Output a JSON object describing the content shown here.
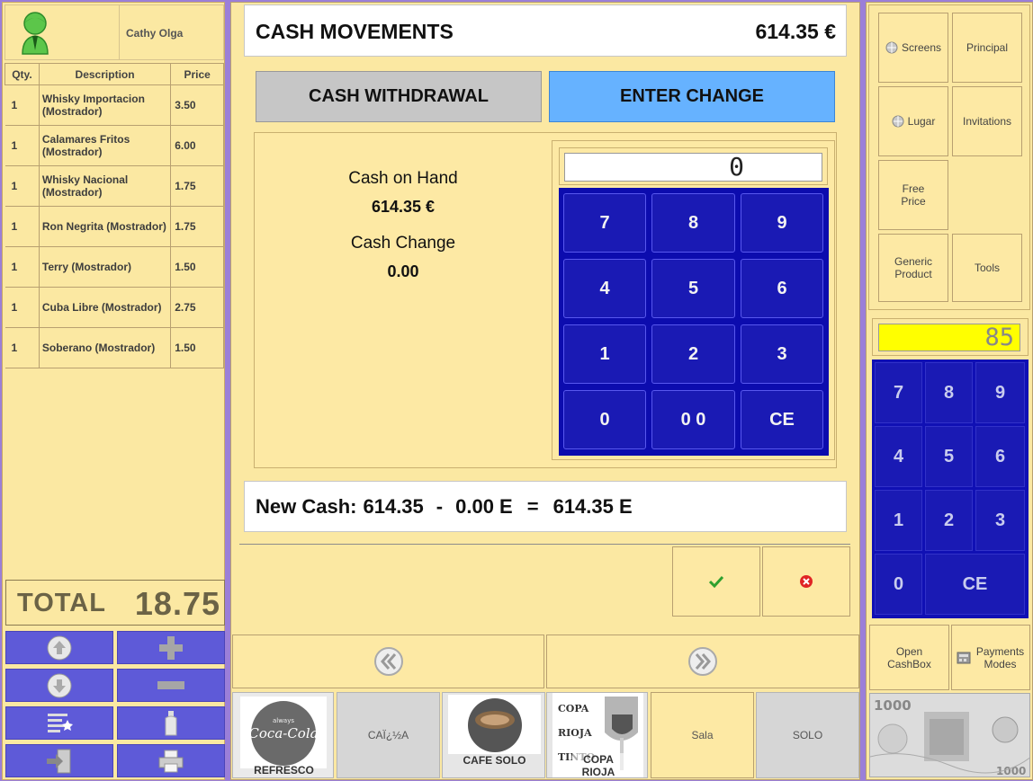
{
  "user": {
    "name": "Cathy Olga"
  },
  "ticket": {
    "headers": {
      "qty": "Qty.",
      "description": "Description",
      "price": "Price"
    },
    "lines": [
      {
        "qty": "1",
        "description": "Whisky Importacion (Mostrador)",
        "price": "3.50"
      },
      {
        "qty": "1",
        "description": "Calamares Fritos (Mostrador)",
        "price": "6.00"
      },
      {
        "qty": "1",
        "description": "Whisky Nacional (Mostrador)",
        "price": "1.75"
      },
      {
        "qty": "1",
        "description": "Ron Negrita (Mostrador)",
        "price": "1.75"
      },
      {
        "qty": "1",
        "description": "Terry (Mostrador)",
        "price": "1.50"
      },
      {
        "qty": "1",
        "description": "Cuba Libre (Mostrador)",
        "price": "2.75"
      },
      {
        "qty": "1",
        "description": "Soberano (Mostrador)",
        "price": "1.50"
      }
    ],
    "total_label": "TOTAL",
    "total_value": "18.75"
  },
  "dialog": {
    "title": "CASH MOVEMENTS",
    "title_amount": "614.35 €",
    "withdrawal_button": "CASH WITHDRAWAL",
    "enter_change_button": "ENTER CHANGE",
    "cash_on_hand_label": "Cash on Hand",
    "cash_on_hand_value": "614.35 €",
    "cash_change_label": "Cash Change",
    "cash_change_value": "0.00",
    "display_value": "0",
    "keypad": [
      "7",
      "8",
      "9",
      "4",
      "5",
      "6",
      "1",
      "2",
      "3",
      "0",
      "0 0",
      "CE"
    ],
    "new_cash": {
      "label": "New Cash:",
      "a": "614.35",
      "op1": "-",
      "b": "0.00 E",
      "op2": "=",
      "result": "614.35 E"
    }
  },
  "right": {
    "buttons": [
      {
        "label": "Screens",
        "icon": "globe-icon"
      },
      {
        "label": "Principal"
      },
      {
        "label": "Lugar",
        "icon": "globe-icon"
      },
      {
        "label": "Invitations"
      },
      {
        "label": "Free Price"
      },
      {
        "label": "Generic Product"
      },
      {
        "label": "Tools"
      }
    ],
    "display_value": "85",
    "keypad": [
      "7",
      "8",
      "9",
      "4",
      "5",
      "6",
      "1",
      "2",
      "3",
      "0",
      "CE"
    ],
    "open_cashbox": "Open CashBox",
    "payment_modes": "Payments Modes"
  },
  "products": [
    {
      "label": "REFRESCO",
      "type": "image"
    },
    {
      "label": "CAÏ¿½A",
      "type": "text"
    },
    {
      "label": "CAFE SOLO",
      "type": "image"
    },
    {
      "label": "COPA RIOJA",
      "type": "image",
      "image_text": "COPA RIOJA TINTO"
    },
    {
      "label": "Sala",
      "type": "text"
    },
    {
      "label": "SOLO",
      "type": "text"
    }
  ],
  "colors": {
    "accent_blue": "#66b2ff",
    "keypad_blue": "#1414b8",
    "panel_yellow": "#fde9a4",
    "frame_purple": "#9b7fd8"
  }
}
